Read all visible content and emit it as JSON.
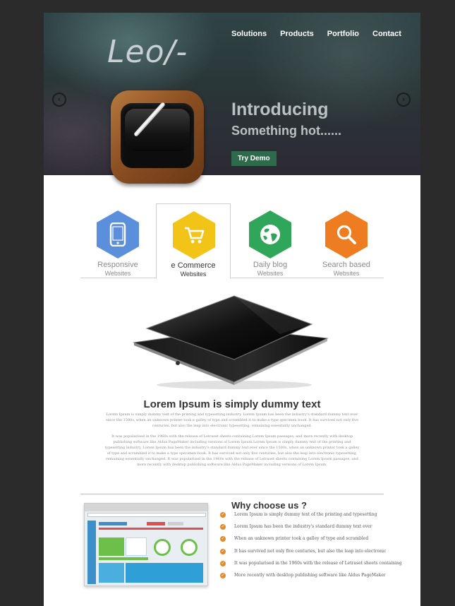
{
  "header": {
    "logo": "Leo/-",
    "nav": [
      "Solutions",
      "Products",
      "Portfolio",
      "Contact"
    ]
  },
  "hero": {
    "title": "Introducing",
    "subtitle": "Something hot......",
    "cta": "Try Demo",
    "prev_icon": "chevron-left-circle-icon",
    "next_icon": "chevron-right-circle-icon",
    "colors": {
      "cta": "#2e6b4c"
    }
  },
  "features": [
    {
      "line1": "Responsive",
      "line2": "Websites",
      "icon": "smartphone-icon",
      "color": "#5b8fdb",
      "active": false
    },
    {
      "line1": "e Commerce",
      "line2": "Websites",
      "icon": "shopping-cart-icon",
      "color": "#f2c417",
      "active": true
    },
    {
      "line1": "Daily blog",
      "line2": "Websites",
      "icon": "globe-icon",
      "color": "#2fa65a",
      "active": false
    },
    {
      "line1": "Search based",
      "line2": "Websites",
      "icon": "search-icon",
      "color": "#ee7d22",
      "active": false
    }
  ],
  "main": {
    "title": "Lorem Ipsum is simply dummy text",
    "para1": "Lorem Ipsum is simply dummy text of the printing and typesetting industry. Lorem Ipsum has been the industry's standard dummy text ever since the 1500s, when an unknown printer took a galley of type and scrambled it to make a type specimen book. It has survived not only five centuries, but also the leap into electronic typesetting, remaining essentially unchanged.",
    "para2": "It was popularised in the 1960s with the release of Letraset sheets containing Lorem Ipsum passages, and more recently with desktop publishing software like Aldus PageMaker including versions of Lorem Ipsum.Lorem Ipsum is simply dummy text of the printing and typesetting industry. Lorem Ipsum has been the industry's standard dummy text ever since the 1500s, when an unknown printer took a galley of type and scrambled it to make a type specimen book. It has survived not only five centuries, but also the leap into electronic typesetting, remaining essentially unchanged. It was popularised in the 1960s with the release of Letraset sheets containing Lorem Ipsum passages, and more recently with desktop publishing software like Aldus PageMaker including versions of Lorem Ipsum."
  },
  "why": {
    "title": "Why choose us ?",
    "items": [
      "Lorem Ipsum is simply dummy text of the printing and typesetting",
      "Lorem Ipsum has been the industry's standard dummy text ever",
      "When an unknown printer took a galley of type and scrambled",
      "It has survived not only five centuries, but also the leap into electronic",
      "It was popularised in the 1960s with the release of Letraset sheets containing",
      "More recently with desktop publishing software like Aldus PageMaker"
    ],
    "bullet_icon": "check-circle-icon",
    "bullet_color": "#e38b2c"
  }
}
